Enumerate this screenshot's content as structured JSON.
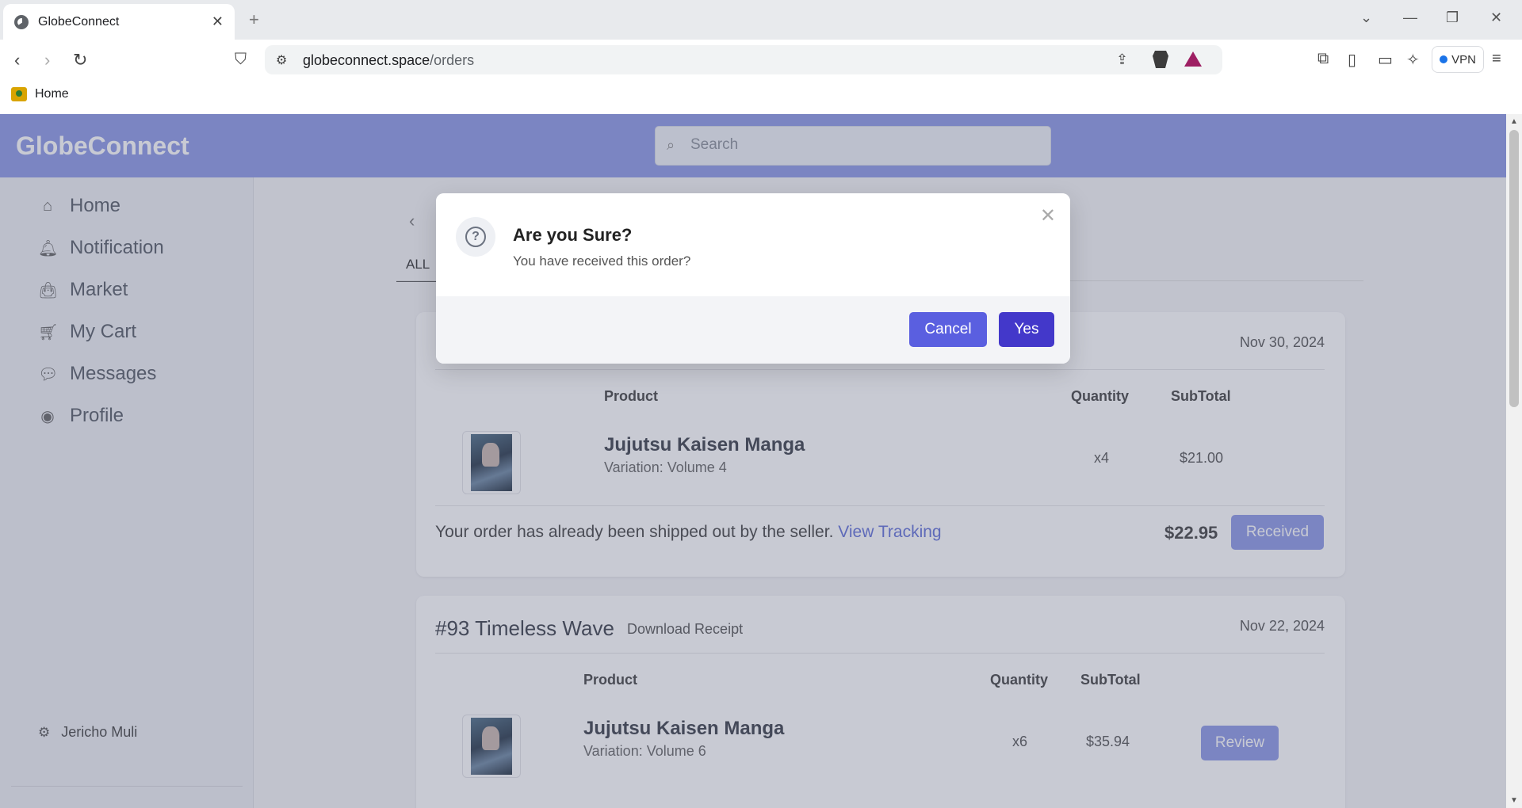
{
  "browser": {
    "tab_title": "GlobeConnect",
    "url_host": "globeconnect.space",
    "url_path": "/orders",
    "bookmark_home": "Home",
    "vpn_label": "VPN"
  },
  "app": {
    "brand": "GlobeConnect",
    "search_placeholder": "Search",
    "accent_color": "#8c98e6"
  },
  "sidebar": {
    "items": [
      {
        "label": "Home",
        "icon": "home-icon"
      },
      {
        "label": "Notification",
        "icon": "bell-icon"
      },
      {
        "label": "Market",
        "icon": "bag-icon"
      },
      {
        "label": "My Cart",
        "icon": "cart-icon"
      },
      {
        "label": "Messages",
        "icon": "chat-icon"
      },
      {
        "label": "Profile",
        "icon": "user-circle-icon"
      }
    ],
    "user_name": "Jericho Muli"
  },
  "filters": {
    "active_tab": "ALL"
  },
  "orders": [
    {
      "date": "Nov 30, 2024",
      "columns": {
        "product": "Product",
        "quantity": "Quantity",
        "subtotal": "SubTotal"
      },
      "product_name": "Jujutsu Kaisen Manga",
      "variation": "Variation: Volume 4",
      "quantity": "x4",
      "subtotal": "$21.00",
      "ship_note": "Your order has already been shipped out by the seller.",
      "tracking_link": "View Tracking",
      "total": "$22.95",
      "action": "Received"
    },
    {
      "title": "#93 Timeless Wave",
      "receipt_link": "Download Receipt",
      "date": "Nov 22, 2024",
      "columns": {
        "product": "Product",
        "quantity": "Quantity",
        "subtotal": "SubTotal"
      },
      "product_name": "Jujutsu Kaisen Manga",
      "variation": "Variation: Volume 6",
      "quantity": "x6",
      "subtotal": "$35.94",
      "action": "Review"
    }
  ],
  "dialog": {
    "title": "Are you Sure?",
    "message": "You have received this order?",
    "cancel_label": "Cancel",
    "confirm_label": "Yes"
  }
}
